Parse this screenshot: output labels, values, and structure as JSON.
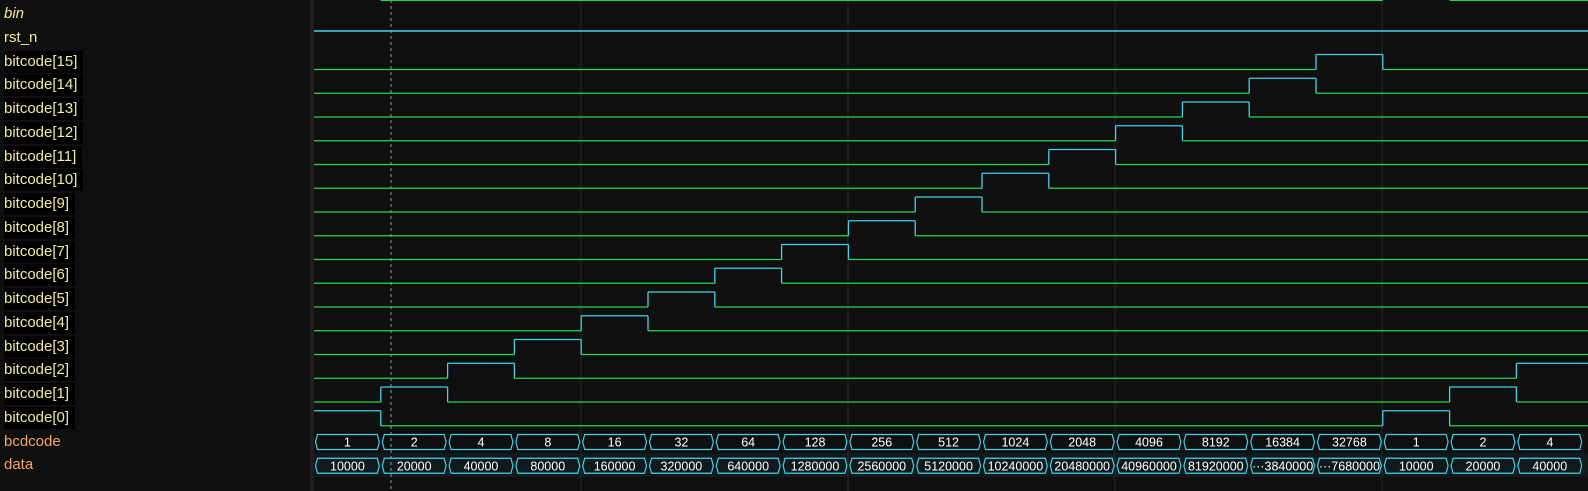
{
  "signals": [
    {
      "name": "bin",
      "style": "italic-yellow"
    },
    {
      "name": "rst_n",
      "style": "yellow"
    },
    {
      "name": "bitcode[15]",
      "style": "yellow"
    },
    {
      "name": "bitcode[14]",
      "style": "yellow"
    },
    {
      "name": "bitcode[13]",
      "style": "yellow"
    },
    {
      "name": "bitcode[12]",
      "style": "yellow"
    },
    {
      "name": "bitcode[11]",
      "style": "yellow"
    },
    {
      "name": "bitcode[10]",
      "style": "yellow"
    },
    {
      "name": "bitcode[9]",
      "style": "yellow"
    },
    {
      "name": "bitcode[8]",
      "style": "yellow"
    },
    {
      "name": "bitcode[7]",
      "style": "yellow"
    },
    {
      "name": "bitcode[6]",
      "style": "yellow"
    },
    {
      "name": "bitcode[5]",
      "style": "yellow"
    },
    {
      "name": "bitcode[4]",
      "style": "yellow"
    },
    {
      "name": "bitcode[3]",
      "style": "yellow"
    },
    {
      "name": "bitcode[2]",
      "style": "yellow"
    },
    {
      "name": "bitcode[1]",
      "style": "yellow"
    },
    {
      "name": "bitcode[0]",
      "style": "yellow"
    },
    {
      "name": "bcdcode",
      "style": "orange"
    },
    {
      "name": "data",
      "style": "orange"
    }
  ],
  "bcdcode_values": [
    "1",
    "2",
    "4",
    "8",
    "16",
    "32",
    "64",
    "128",
    "256",
    "512",
    "1024",
    "2048",
    "4096",
    "8192",
    "16384",
    "32768",
    "1",
    "2",
    "4"
  ],
  "data_values": [
    "10000",
    "20000",
    "40000",
    "80000",
    "160000",
    "320000",
    "640000",
    "1280000",
    "2560000",
    "5120000",
    "10240000",
    "20480000",
    "40960000",
    "81920000",
    "···3840000",
    "···7680000",
    "10000",
    "20000",
    "40000"
  ],
  "colors": {
    "background": "#0f0f10",
    "wave_low": "#23d84a",
    "wave_high": "#3fd3e8",
    "bus": "#3fd3e8",
    "grid": "#2a2a2c",
    "signal_name": "#f3eb9c",
    "bus_name": "#f5a46a"
  }
}
